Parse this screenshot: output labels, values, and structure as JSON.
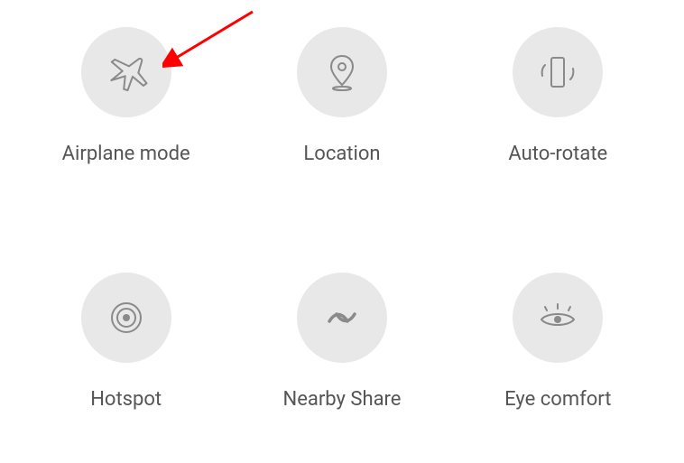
{
  "tiles": [
    {
      "label": "Airplane mode",
      "icon": "airplane-icon"
    },
    {
      "label": "Location",
      "icon": "location-icon"
    },
    {
      "label": "Auto-rotate",
      "icon": "auto-rotate-icon"
    },
    {
      "label": "Hotspot",
      "icon": "hotspot-icon"
    },
    {
      "label": "Nearby Share",
      "icon": "nearby-share-icon"
    },
    {
      "label": "Eye comfort",
      "icon": "eye-comfort-icon"
    }
  ],
  "annotation": {
    "type": "arrow",
    "target": "airplane-mode-toggle",
    "color": "#ff0000"
  }
}
